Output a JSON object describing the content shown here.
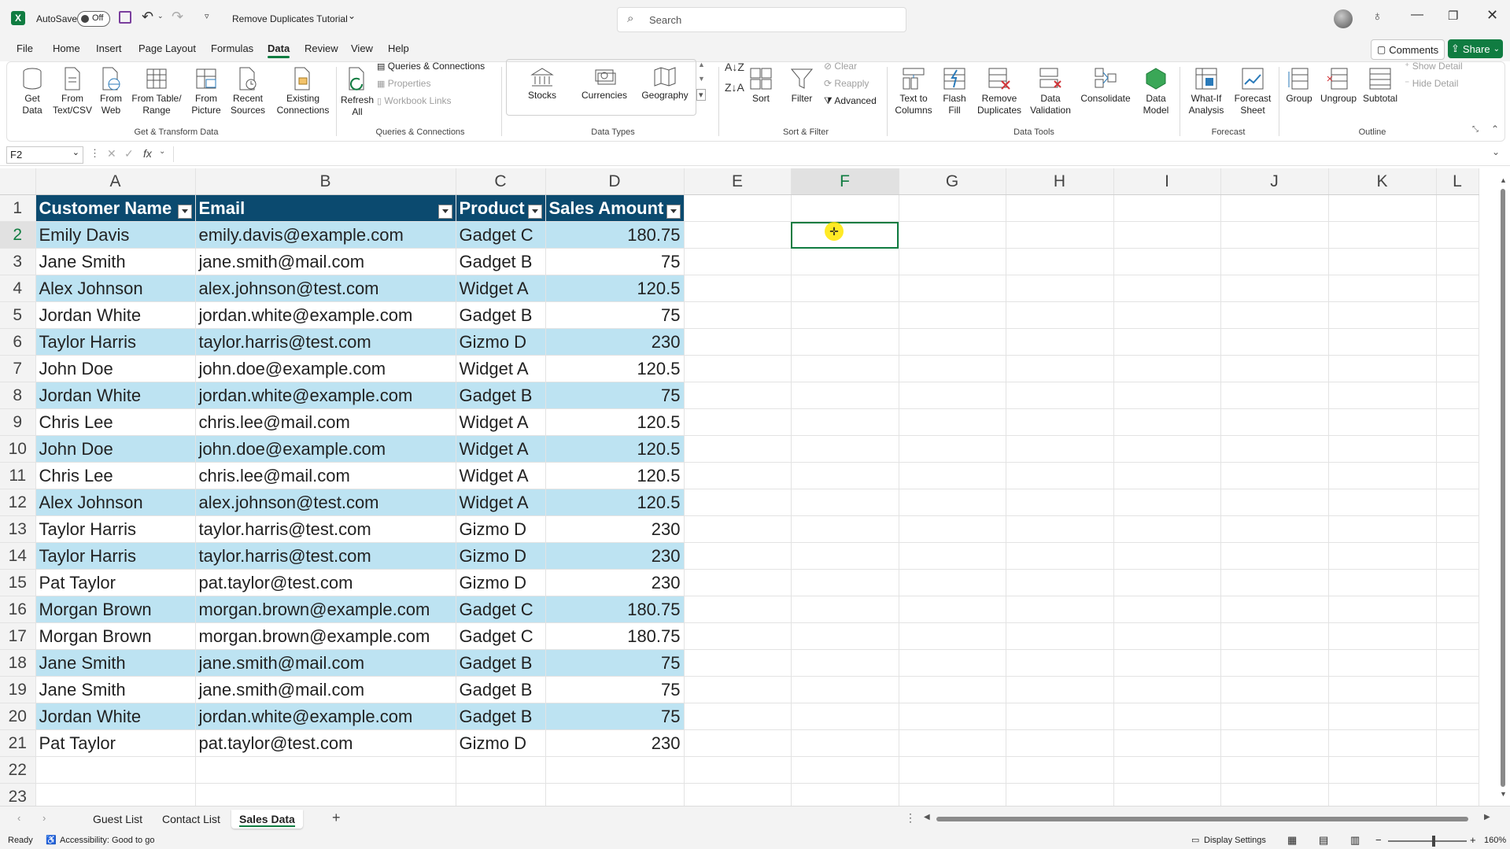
{
  "titlebar": {
    "autosave_label": "AutoSave",
    "autosave_state": "Off",
    "doc_title": "Remove Duplicates Tutorial",
    "search_placeholder": "Search"
  },
  "tabs": [
    "File",
    "Home",
    "Insert",
    "Page Layout",
    "Formulas",
    "Data",
    "Review",
    "View",
    "Help"
  ],
  "active_tab": "Data",
  "comments_label": "Comments",
  "share_label": "Share",
  "ribbon": {
    "get_data": "Get Data",
    "from_text_csv": "From Text/CSV",
    "from_web": "From Web",
    "from_table_range": "From Table/ Range",
    "from_picture": "From Picture",
    "recent_sources": "Recent Sources",
    "existing_connections": "Existing Connections",
    "group_get_transform": "Get & Transform Data",
    "refresh_all": "Refresh All",
    "queries_connections_btn": "Queries & Connections",
    "properties": "Properties",
    "workbook_links": "Workbook Links",
    "group_queries": "Queries & Connections",
    "stocks": "Stocks",
    "currencies": "Currencies",
    "geography": "Geography",
    "group_data_types": "Data Types",
    "sort": "Sort",
    "filter": "Filter",
    "clear": "Clear",
    "reapply": "Reapply",
    "advanced": "Advanced",
    "group_sort_filter": "Sort & Filter",
    "text_to_columns": "Text to Columns",
    "flash_fill": "Flash Fill",
    "remove_duplicates": "Remove Duplicates",
    "data_validation": "Data Validation",
    "consolidate": "Consolidate",
    "data_model": "Data Model",
    "group_data_tools": "Data Tools",
    "what_if": "What-If Analysis",
    "forecast_sheet": "Forecast Sheet",
    "group_forecast": "Forecast",
    "group": "Group",
    "ungroup": "Ungroup",
    "subtotal": "Subtotal",
    "show_detail": "Show Detail",
    "hide_detail": "Hide Detail",
    "group_outline": "Outline"
  },
  "formula_bar": {
    "name_box": "F2",
    "fx": "fx",
    "content": ""
  },
  "columns": [
    "A",
    "B",
    "C",
    "D",
    "E",
    "F",
    "G",
    "H",
    "I",
    "J",
    "K",
    "L"
  ],
  "selected_col": "F",
  "selected_row": "2",
  "headers": [
    "Customer Name",
    "Email",
    "Product",
    "Sales Amount"
  ],
  "rows": [
    [
      "Emily Davis",
      "emily.davis@example.com",
      "Gadget C",
      "180.75"
    ],
    [
      "Jane Smith",
      "jane.smith@mail.com",
      "Gadget B",
      "75"
    ],
    [
      "Alex Johnson",
      "alex.johnson@test.com",
      "Widget A",
      "120.5"
    ],
    [
      "Jordan White",
      "jordan.white@example.com",
      "Gadget B",
      "75"
    ],
    [
      "Taylor Harris",
      "taylor.harris@test.com",
      "Gizmo D",
      "230"
    ],
    [
      "John Doe",
      "john.doe@example.com",
      "Widget A",
      "120.5"
    ],
    [
      "Jordan White",
      "jordan.white@example.com",
      "Gadget B",
      "75"
    ],
    [
      "Chris Lee",
      "chris.lee@mail.com",
      "Widget A",
      "120.5"
    ],
    [
      "John Doe",
      "john.doe@example.com",
      "Widget A",
      "120.5"
    ],
    [
      "Chris Lee",
      "chris.lee@mail.com",
      "Widget A",
      "120.5"
    ],
    [
      "Alex Johnson",
      "alex.johnson@test.com",
      "Widget A",
      "120.5"
    ],
    [
      "Taylor Harris",
      "taylor.harris@test.com",
      "Gizmo D",
      "230"
    ],
    [
      "Taylor Harris",
      "taylor.harris@test.com",
      "Gizmo D",
      "230"
    ],
    [
      "Pat Taylor",
      "pat.taylor@test.com",
      "Gizmo D",
      "230"
    ],
    [
      "Morgan Brown",
      "morgan.brown@example.com",
      "Gadget C",
      "180.75"
    ],
    [
      "Morgan Brown",
      "morgan.brown@example.com",
      "Gadget C",
      "180.75"
    ],
    [
      "Jane Smith",
      "jane.smith@mail.com",
      "Gadget B",
      "75"
    ],
    [
      "Jane Smith",
      "jane.smith@mail.com",
      "Gadget B",
      "75"
    ],
    [
      "Jordan White",
      "jordan.white@example.com",
      "Gadget B",
      "75"
    ],
    [
      "Pat Taylor",
      "pat.taylor@test.com",
      "Gizmo D",
      "230"
    ]
  ],
  "extra_rows": [
    "22",
    "23"
  ],
  "sheet_tabs": [
    "Guest List",
    "Contact List",
    "Sales Data"
  ],
  "active_sheet": "Sales Data",
  "status": {
    "ready": "Ready",
    "accessibility": "Accessibility: Good to go",
    "display_settings": "Display Settings",
    "zoom": "160%"
  },
  "colors": {
    "table_header": "#0b4a6f",
    "band": "#bde3f2",
    "accent": "#107c41"
  }
}
